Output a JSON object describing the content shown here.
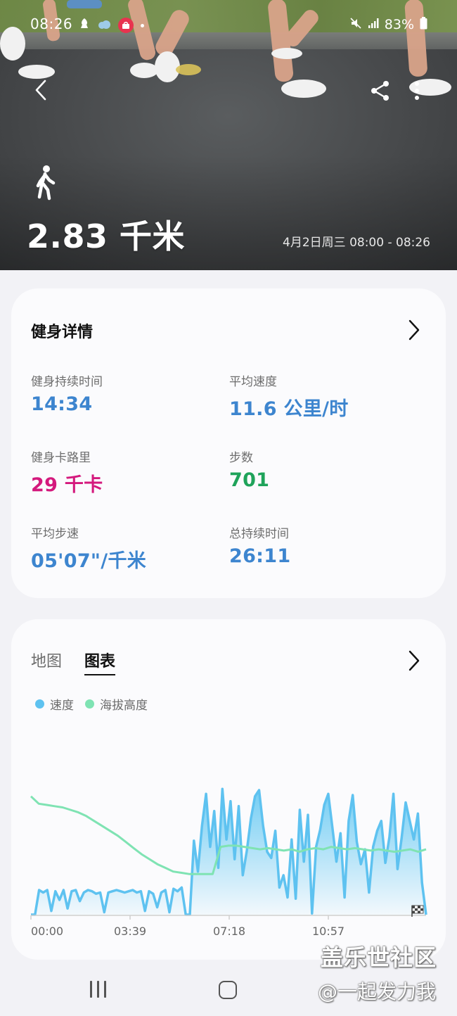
{
  "status": {
    "time": "08:26",
    "battery": "83%"
  },
  "hero": {
    "distance": "2.83 千米",
    "date_range": "4月2日周三 08:00 - 08:26",
    "activity_icon": "walking-person-icon"
  },
  "details": {
    "title": "健身详情",
    "stats": [
      {
        "label": "健身持续时间",
        "value": "14:34",
        "color": "#3d85cf"
      },
      {
        "label": "平均速度",
        "value": "11.6 公里/时",
        "color": "#3d85cf"
      },
      {
        "label": "健身卡路里",
        "value": "29 千卡",
        "color": "#d4197d"
      },
      {
        "label": "步数",
        "value": "701",
        "color": "#1fa35a"
      },
      {
        "label": "平均步速",
        "value": "05'07\"/千米",
        "color": "#3d85cf"
      },
      {
        "label": "总持续时间",
        "value": "26:11",
        "color": "#3d85cf"
      }
    ]
  },
  "chart_card": {
    "tabs": [
      {
        "label": "地图"
      },
      {
        "label": "图表"
      }
    ],
    "active_tab": "图表",
    "legend": [
      {
        "label": "速度",
        "color": "#5ec2f0"
      },
      {
        "label": "海拔高度",
        "color": "#7fe3b3"
      }
    ],
    "x_ticks": [
      "00:00",
      "03:39",
      "07:18",
      "10:57"
    ]
  },
  "chart_data": {
    "type": "area",
    "x_ticks": [
      "00:00",
      "03:39",
      "07:18",
      "10:57"
    ],
    "series": [
      {
        "name": "速度",
        "color": "#5ec2f0",
        "values": [
          0,
          0,
          2,
          1.8,
          2,
          0.3,
          1.9,
          1.2,
          2,
          0.5,
          1.9,
          2,
          1.1,
          1.8,
          2,
          1.9,
          1.7,
          1.8,
          0.2,
          1.8,
          1.9,
          2,
          1.9,
          1.8,
          1.9,
          2,
          1.8,
          1.9,
          0.3,
          1.9,
          1.7,
          0.6,
          1.8,
          2,
          0.2,
          2.1,
          1.9,
          2.2,
          0,
          0,
          6,
          3.5,
          7.2,
          9.8,
          5.5,
          8.4,
          3.8,
          10.2,
          6.1,
          9.2,
          4.5,
          8.8,
          3.2,
          5.2,
          7.8,
          9.6,
          10.1,
          7.2,
          5.1,
          4.6,
          6.8,
          2.2,
          3.2,
          1.4,
          6.1,
          1.3,
          8.5,
          4.3,
          8.1,
          0.1,
          5.5,
          6.9,
          8.9,
          9.8,
          7.1,
          4.3,
          6.6,
          1.4,
          7.6,
          9.7,
          5.9,
          4.1,
          5.3,
          1.8,
          5.5,
          6.8,
          7.6,
          4.2,
          6.3,
          9.8,
          3.7,
          6.2,
          9.1,
          7.6,
          6.1,
          8.2,
          2.6,
          0
        ]
      },
      {
        "name": "海拔高度",
        "color": "#7fe3b3",
        "values": [
          9.6,
          9,
          8.9,
          8.8,
          8.7,
          8.5,
          8.3,
          8,
          7.6,
          7.2,
          6.8,
          6.4,
          5.9,
          5.4,
          4.9,
          4.5,
          4.1,
          3.8,
          3.5,
          3.4,
          3.3,
          3.3,
          3.3,
          3.3,
          5.5,
          5.6,
          5.6,
          5.5,
          5.4,
          5.3,
          5.4,
          5.3,
          5.2,
          5.3,
          5.1,
          5.3,
          5.4,
          5.3,
          5.5,
          5.4,
          5.3,
          5.4,
          5.3,
          5.2,
          5.3,
          5.2,
          5.1,
          5.2,
          5.3,
          5.1,
          5.3
        ]
      }
    ]
  },
  "watermark": {
    "line1": "盖乐世社区",
    "line2": "@一起发力我"
  }
}
